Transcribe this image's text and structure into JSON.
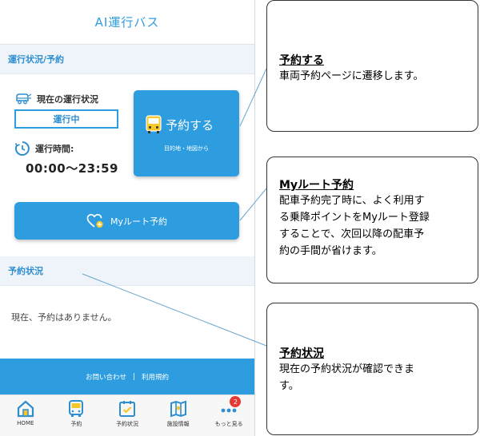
{
  "app": {
    "title": "AI運行バス"
  },
  "operation": {
    "section_title": "運行状況/予約",
    "current_status_label": "現在の運行状況",
    "current_status_value": "運行中",
    "hours_label": "運行時間:",
    "hours_value": "00:00〜23:59"
  },
  "reserve_button": {
    "label": "予約する",
    "sub": "目的地・地図から"
  },
  "myroute_button": {
    "label": "Myルート予約"
  },
  "reservations": {
    "section_title": "予約状況",
    "empty_text": "現在、予約はありません。"
  },
  "footer": {
    "contact": "お問い合わせ",
    "separator": "|",
    "terms": "利用規約"
  },
  "tabs": [
    {
      "label": "HOME",
      "icon": "home-icon"
    },
    {
      "label": "予約",
      "icon": "bus-icon"
    },
    {
      "label": "予約状況",
      "icon": "calendar-check-icon"
    },
    {
      "label": "施設情報",
      "icon": "map-icon"
    },
    {
      "label": "もっと見る",
      "icon": "more-dots-icon",
      "badge": "2"
    }
  ],
  "callouts": [
    {
      "title": "予約する",
      "lines": [
        "車両予約ページに遷移します。"
      ]
    },
    {
      "title": "Myルート予約",
      "lines": [
        "配車予約完了時に、よく利用す",
        "る乗降ポイントをMyルート登録",
        "することで、次回以降の配車予",
        "約の手間が省けます。"
      ]
    },
    {
      "title": "予約状況",
      "lines": [
        "現在の予約状況が確認できま",
        "す。"
      ]
    }
  ],
  "colors": {
    "accent": "#2d9de0",
    "section_bg": "#eef4fa",
    "badge": "#e53935"
  }
}
